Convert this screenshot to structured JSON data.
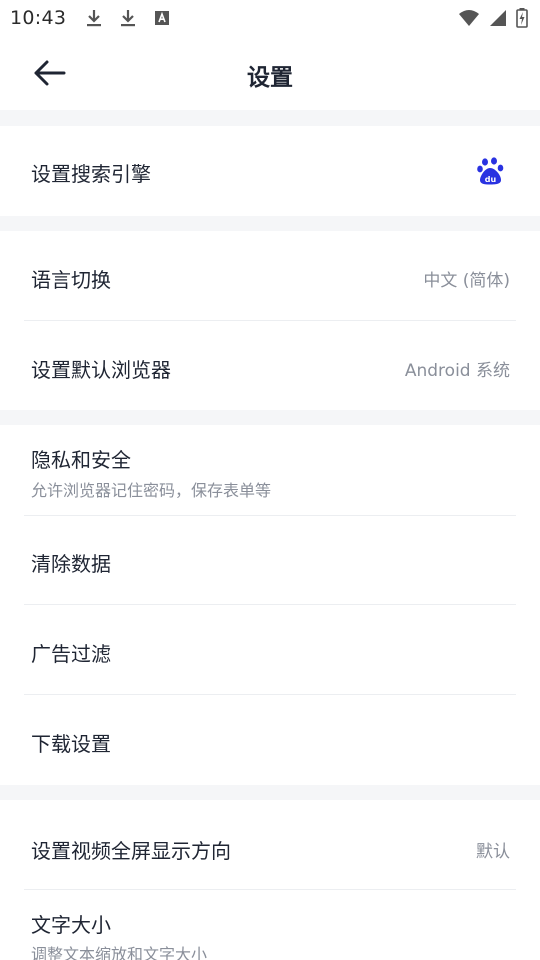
{
  "status_bar": {
    "time": "10:43",
    "left_icons": [
      "download-icon",
      "download-icon",
      "font-a-icon"
    ],
    "right_icons": [
      "wifi-icon",
      "signal-icon",
      "battery-charging-icon"
    ]
  },
  "header": {
    "back_icon": "arrow-left-icon",
    "title": "设置"
  },
  "groups": [
    {
      "items": [
        {
          "label": "设置搜索引擎",
          "value_icon": "baidu-paw-icon",
          "value_icon_text": "du"
        }
      ]
    },
    {
      "items": [
        {
          "label": "语言切换",
          "value": "中文 (简体)"
        },
        {
          "label": "设置默认浏览器",
          "value": "Android 系统"
        }
      ]
    },
    {
      "items": [
        {
          "label": "隐私和安全",
          "subtitle": "允许浏览器记住密码，保存表单等"
        },
        {
          "label": "清除数据"
        },
        {
          "label": "广告过滤"
        },
        {
          "label": "下载设置"
        }
      ]
    },
    {
      "items": [
        {
          "label": "设置视频全屏显示方向",
          "value": "默认"
        },
        {
          "label": "文字大小",
          "subtitle": "调整文本缩放和文字大小"
        }
      ]
    }
  ],
  "colors": {
    "accent_icon": "#2932e1",
    "section_gap": "#f5f6f8",
    "text_primary": "#1f2533",
    "text_secondary": "#8a8f9a"
  }
}
